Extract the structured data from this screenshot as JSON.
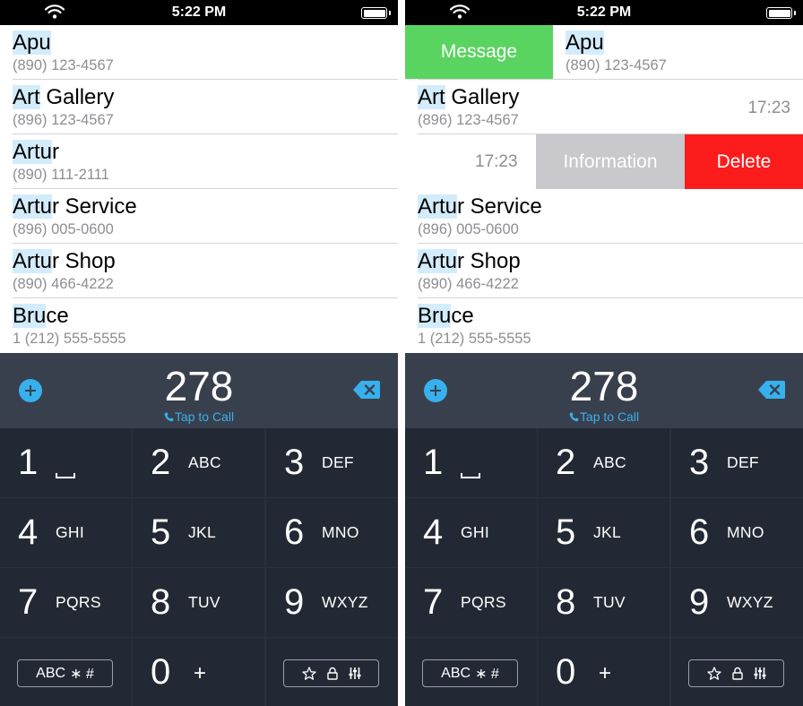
{
  "status_bar": {
    "time": "5:22 PM"
  },
  "highlight": "278",
  "contacts": [
    {
      "name_hl": "Apu",
      "name_rest": "",
      "phone": "(890) 123-4567"
    },
    {
      "name_hl": "Art",
      "name_rest": " Gallery",
      "phone": "(896) 123-4567"
    },
    {
      "name_hl": "Artu",
      "name_rest": "r",
      "phone": "(890) 111-2111"
    },
    {
      "name_hl": "Artu",
      "name_rest": "r Service",
      "phone": "(896) 005-0600"
    },
    {
      "name_hl": "Artu",
      "name_rest": "r Shop",
      "phone": "(890) 466-4222"
    },
    {
      "name_hl": "Bru",
      "name_rest": "ce",
      "phone": "1 (212) 555-5555"
    }
  ],
  "call_time": "17:23",
  "swipe_actions": {
    "message_label": "Message",
    "information_label": "Information",
    "delete_label": "Delete"
  },
  "dialer": {
    "number": "278",
    "tap_to_call": "Tap to Call"
  },
  "keypad": {
    "keys": [
      {
        "digit": "1",
        "letters": ""
      },
      {
        "digit": "2",
        "letters": "ABC"
      },
      {
        "digit": "3",
        "letters": "DEF"
      },
      {
        "digit": "4",
        "letters": "GHI"
      },
      {
        "digit": "5",
        "letters": "JKL"
      },
      {
        "digit": "6",
        "letters": "MNO"
      },
      {
        "digit": "7",
        "letters": "PQRS"
      },
      {
        "digit": "8",
        "letters": "TUV"
      },
      {
        "digit": "9",
        "letters": "WXYZ"
      }
    ],
    "zero": "0",
    "zero_plus": "+",
    "abc_label": "ABC",
    "abc_symbols": "∗ #"
  },
  "colors": {
    "accent_blue": "#37b0ee",
    "message_green": "#5ad460",
    "info_gray": "#c8c8cd",
    "delete_red": "#fd1c1c",
    "highlight_blue": "#d3ecfb",
    "keypad_bg": "#232934",
    "dial_header_bg": "#39404d"
  }
}
